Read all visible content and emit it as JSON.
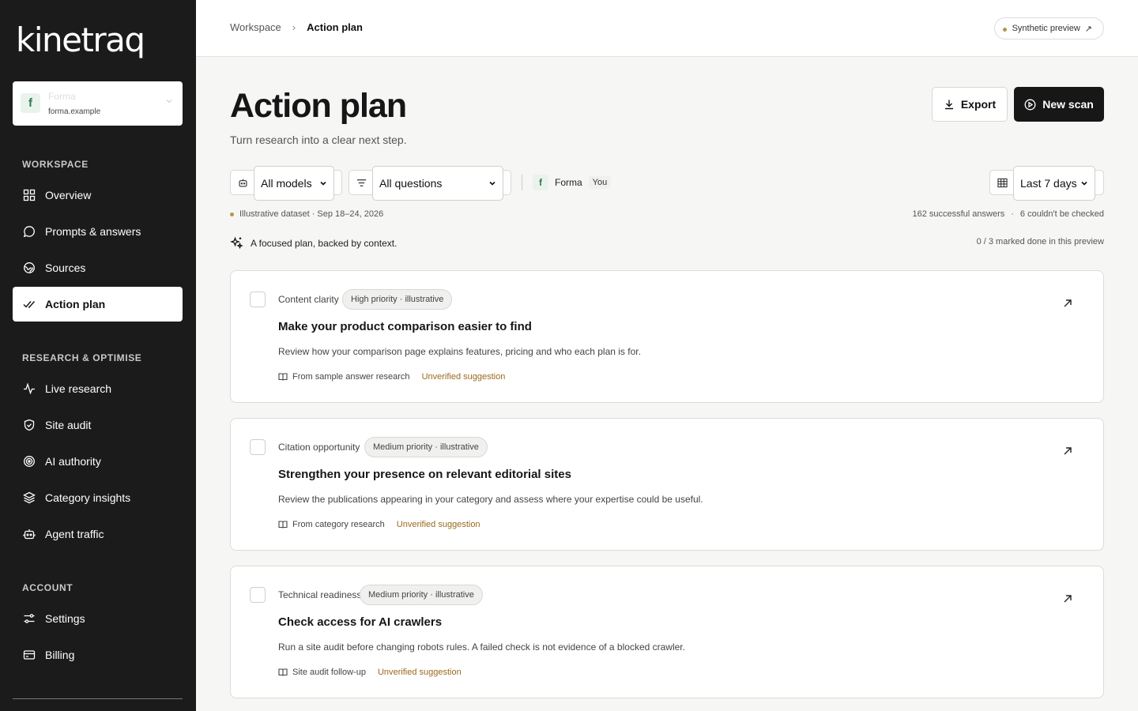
{
  "app": {
    "logo": "kinetraq"
  },
  "workspace": {
    "name": "Forma",
    "domain": "forma.example",
    "initial": "f"
  },
  "sidebar": {
    "sections": [
      {
        "label": "WORKSPACE"
      },
      {
        "label": "RESEARCH & OPTIMISE"
      },
      {
        "label": "ACCOUNT"
      }
    ],
    "items": [
      {
        "label": "Overview",
        "icon": "grid-icon"
      },
      {
        "label": "Prompts & answers",
        "icon": "chat-bubble-icon"
      },
      {
        "label": "Sources",
        "icon": "globe-icon"
      },
      {
        "label": "Action plan",
        "icon": "double-check-icon",
        "active": true
      },
      {
        "label": "Live research",
        "icon": "pulse-icon"
      },
      {
        "label": "Site audit",
        "icon": "shield-check-icon"
      },
      {
        "label": "AI authority",
        "icon": "target-icon"
      },
      {
        "label": "Category insights",
        "icon": "layers-icon"
      },
      {
        "label": "Agent traffic",
        "icon": "robot-icon"
      },
      {
        "label": "Settings",
        "icon": "sliders-icon"
      },
      {
        "label": "Billing",
        "icon": "credit-card-icon"
      }
    ]
  },
  "breadcrumb": {
    "parent": "Workspace",
    "separator": "›",
    "current": "Action plan"
  },
  "preview_badge": {
    "label": "Synthetic preview",
    "arrow": "↗"
  },
  "header": {
    "title": "Action plan",
    "subtitle": "Turn research into a clear next step.",
    "export_label": "Export",
    "new_scan_label": "New scan"
  },
  "filters": {
    "models": "All models",
    "questions": "All questions",
    "brand": "Forma",
    "you_tag": "You",
    "date_range": "Last 7 days"
  },
  "meta": {
    "dataset": "Illustrative dataset · Sep 18–24, 2026",
    "successful": "162 successful answers",
    "dot_sep": "·",
    "failed": "6 couldn't be checked",
    "focus": "A focused plan, backed by context.",
    "done_count": "0 / 3 marked done in this preview"
  },
  "actions": [
    {
      "category": "Content clarity",
      "priority": "High priority · illustrative",
      "title": "Make your product comparison easier to find",
      "description": "Review how your comparison page explains features, pricing and who each plan is for.",
      "source": "From sample answer research",
      "status": "Unverified suggestion"
    },
    {
      "category": "Citation opportunity",
      "priority": "Medium priority · illustrative",
      "title": "Strengthen your presence on relevant editorial sites",
      "description": "Review the publications appearing in your category and assess where your expertise could be useful.",
      "source": "From category research",
      "status": "Unverified suggestion"
    },
    {
      "category": "Technical readiness",
      "priority": "Medium priority · illustrative",
      "title": "Check access for AI crawlers",
      "description": "Run a site audit before changing robots rules. A failed check is not evidence of a blocked crawler.",
      "source": "Site audit follow-up",
      "status": "Unverified suggestion"
    }
  ],
  "colors": {
    "sidebar_bg": "#1b1b1b",
    "page_bg": "#f6f6f5",
    "accent_dot": "#b8934a",
    "warning_text": "#9a6a1e",
    "primary_button": "#171717"
  }
}
